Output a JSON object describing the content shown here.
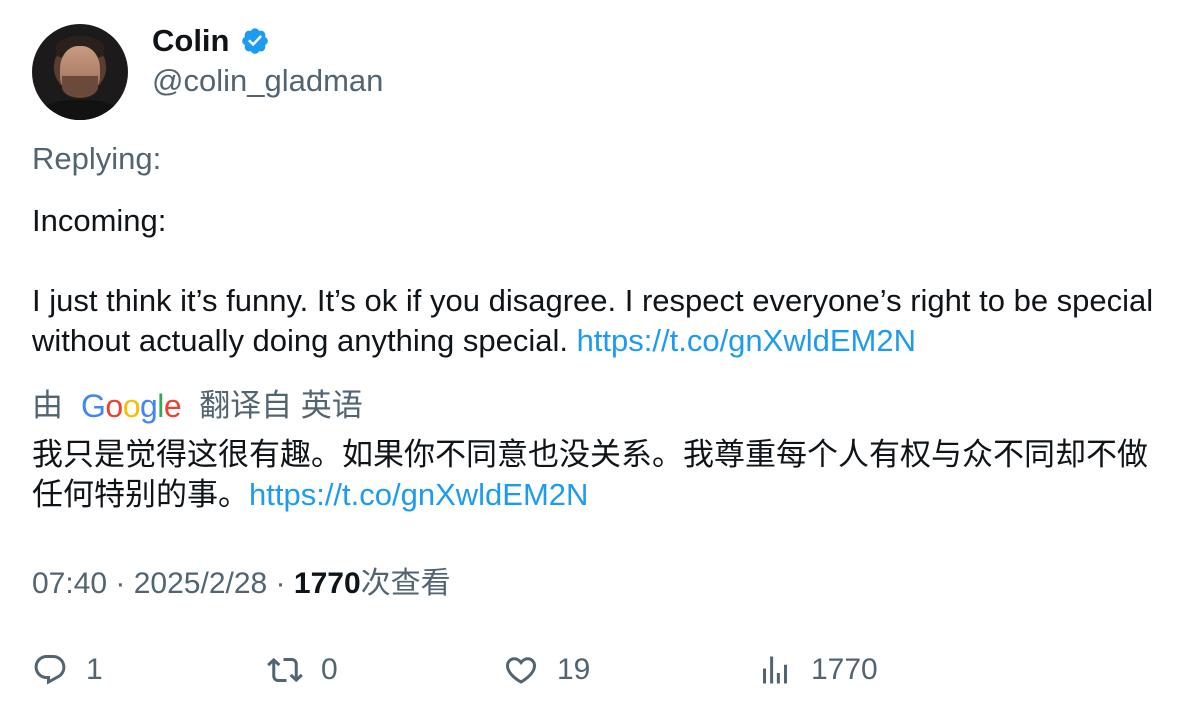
{
  "author": {
    "name": "Colin",
    "handle": "@colin_gladman",
    "verified_color": "#1d9bf0"
  },
  "replying_label": "Replying:",
  "tweet": {
    "line1": "Incoming:",
    "body": "I just think it’s funny. It’s ok if you disagree. I respect everyone’s right to be special without actually doing anything special. ",
    "link": "https://t.co/gnXwldEM2N"
  },
  "translation": {
    "prefix": "由",
    "google_letters": [
      "G",
      "o",
      "o",
      "g",
      "l",
      "e"
    ],
    "suffix": "翻译自 英语",
    "body": "我只是觉得这很有趣。如果你不同意也没关系。我尊重每个人有权与众不同却不做任何特别的事。",
    "link": "https://t.co/gnXwldEM2N"
  },
  "meta": {
    "time": "07:40",
    "sep1": " · ",
    "date": "2025/2/28",
    "sep2": " · ",
    "views": "1770",
    "views_label": "次查看"
  },
  "actions": {
    "replies": "1",
    "retweets": "0",
    "likes": "19",
    "views": "1770"
  }
}
